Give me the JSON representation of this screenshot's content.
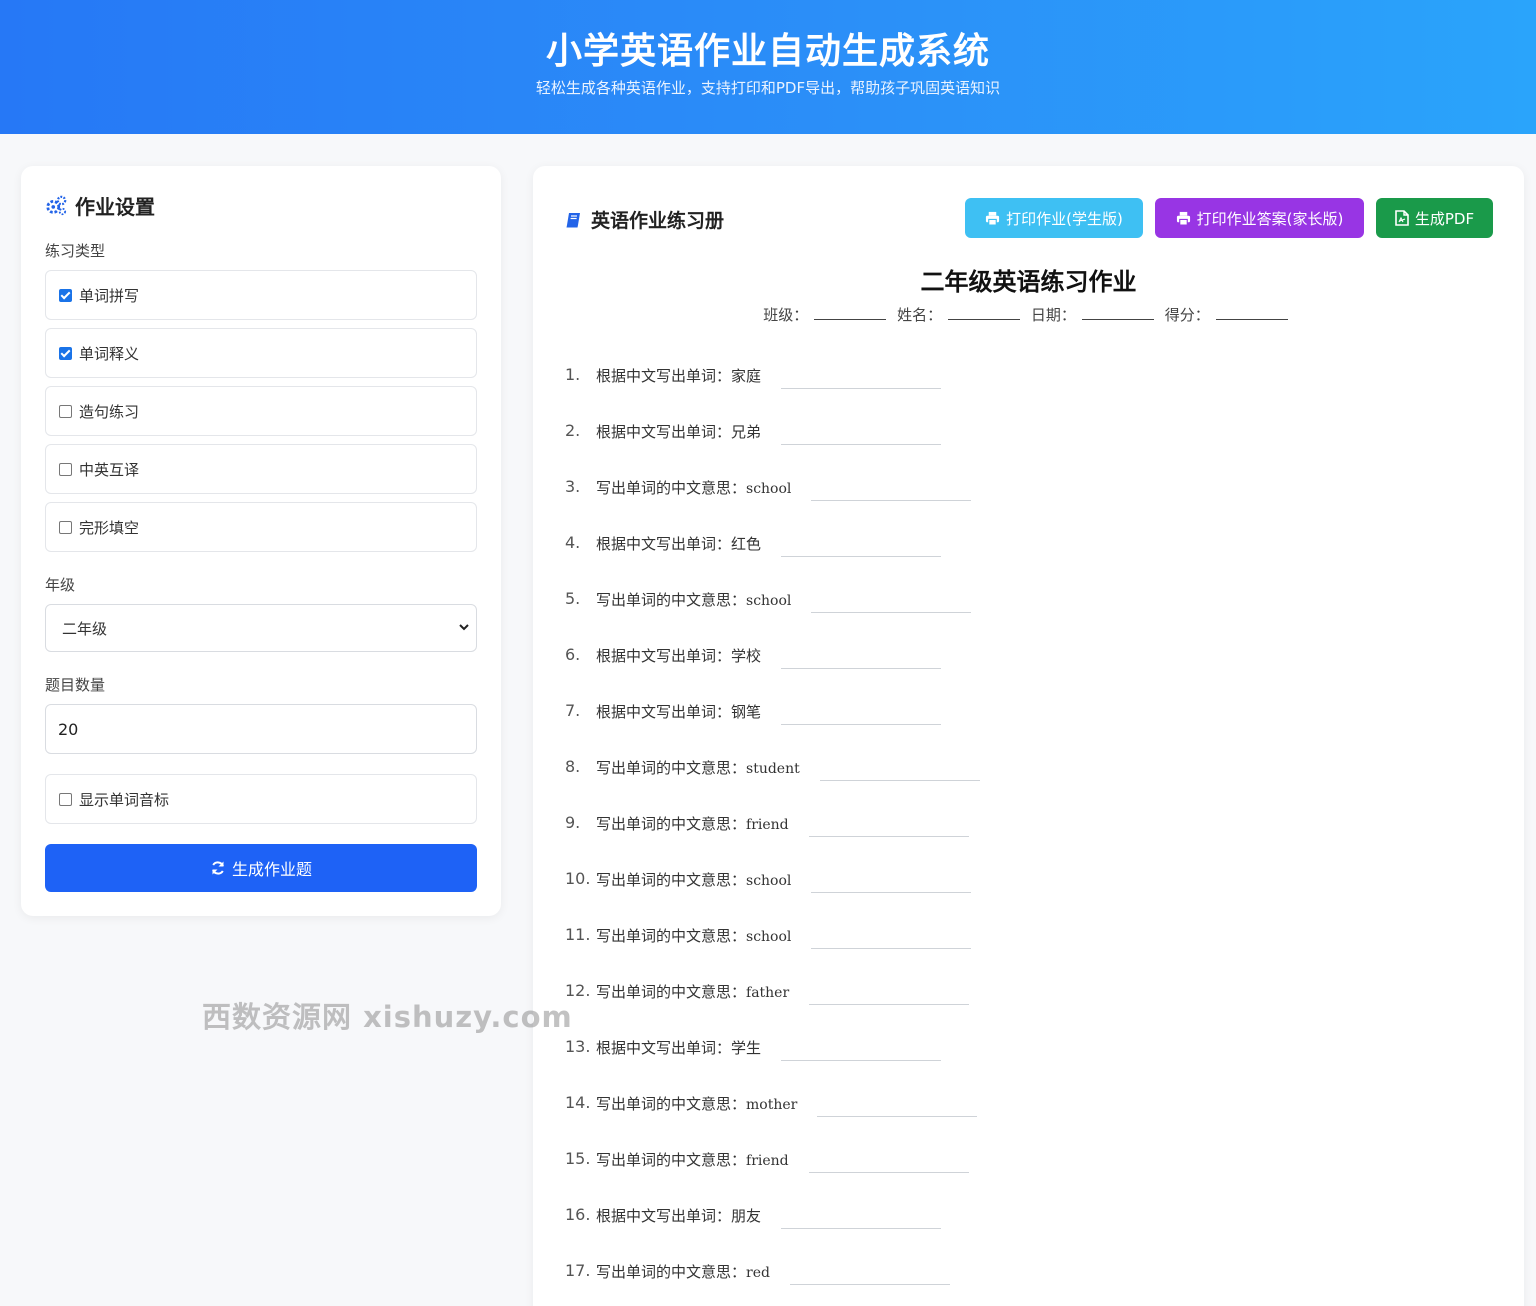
{
  "header": {
    "title": "小学英语作业自动生成系统",
    "subtitle": "轻松生成各种英语作业，支持打印和PDF导出，帮助孩子巩固英语知识"
  },
  "settings": {
    "title": "作业设置",
    "type_label": "练习类型",
    "types": [
      {
        "label": "单词拼写",
        "checked": true
      },
      {
        "label": "单词释义",
        "checked": true
      },
      {
        "label": "造句练习",
        "checked": false
      },
      {
        "label": "中英互译",
        "checked": false
      },
      {
        "label": "完形填空",
        "checked": false
      }
    ],
    "grade_label": "年级",
    "grade_value": "二年级",
    "count_label": "题目数量",
    "count_value": "20",
    "phonetic_label": "显示单词音标",
    "phonetic_checked": false,
    "generate_label": "生成作业题"
  },
  "workbook": {
    "title": "英语作业练习册",
    "print_student_label": "打印作业(学生版)",
    "print_parent_label": "打印作业答案(家长版)",
    "pdf_label": "生成PDF",
    "sheet_title": "二年级英语练习作业",
    "info": {
      "class_label": "班级：",
      "name_label": "姓名：",
      "date_label": "日期：",
      "score_label": "得分："
    },
    "questions": [
      {
        "num": "1.",
        "prompt": "根据中文写出单词：",
        "word": "家庭"
      },
      {
        "num": "2.",
        "prompt": "根据中文写出单词：",
        "word": "兄弟"
      },
      {
        "num": "3.",
        "prompt": "写出单词的中文意思：",
        "word": "school"
      },
      {
        "num": "4.",
        "prompt": "根据中文写出单词：",
        "word": "红色"
      },
      {
        "num": "5.",
        "prompt": "写出单词的中文意思：",
        "word": "school"
      },
      {
        "num": "6.",
        "prompt": "根据中文写出单词：",
        "word": "学校"
      },
      {
        "num": "7.",
        "prompt": "根据中文写出单词：",
        "word": "钢笔"
      },
      {
        "num": "8.",
        "prompt": "写出单词的中文意思：",
        "word": "student"
      },
      {
        "num": "9.",
        "prompt": "写出单词的中文意思：",
        "word": "friend"
      },
      {
        "num": "10.",
        "prompt": "写出单词的中文意思：",
        "word": "school"
      },
      {
        "num": "11.",
        "prompt": "写出单词的中文意思：",
        "word": "school"
      },
      {
        "num": "12.",
        "prompt": "写出单词的中文意思：",
        "word": "father"
      },
      {
        "num": "13.",
        "prompt": "根据中文写出单词：",
        "word": "学生"
      },
      {
        "num": "14.",
        "prompt": "写出单词的中文意思：",
        "word": "mother"
      },
      {
        "num": "15.",
        "prompt": "写出单词的中文意思：",
        "word": "friend"
      },
      {
        "num": "16.",
        "prompt": "根据中文写出单词：",
        "word": "朋友"
      },
      {
        "num": "17.",
        "prompt": "写出单词的中文意思：",
        "word": "red"
      }
    ]
  },
  "watermark": "西数资源网 xishuzy.com",
  "colors": {
    "header_gradient_start": "#2678f6",
    "header_gradient_end": "#2aa4fb",
    "primary_button": "#1e62f6",
    "print_student": "#3ec0f3",
    "print_parent": "#9835e4",
    "pdf": "#1a9a4a",
    "accent_icon": "#2364e8"
  },
  "icons": [
    "cogs-icon",
    "book-icon",
    "print-icon",
    "pdf-file-icon",
    "refresh-icon",
    "chevron-down-icon"
  ]
}
